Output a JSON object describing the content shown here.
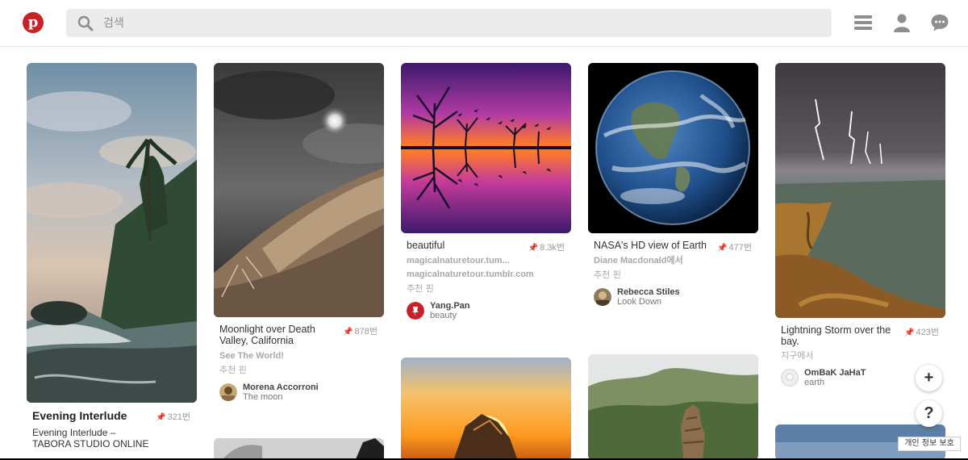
{
  "header": {
    "logo_icon": "pinterest-logo",
    "logo_letter": "p",
    "search_placeholder": "검색",
    "icons": [
      "menu-icon",
      "profile-icon",
      "messages-icon"
    ]
  },
  "pins": [
    {
      "title": "Evening Interlude",
      "count": "321번",
      "description": "Evening Interlude – TABORA STUDIO ONLINE"
    },
    {
      "title": "Moonlight over Death Valley, California",
      "count": "878번",
      "source": "See The World!",
      "recommended": "추천 핀",
      "pinner_name": "Morena Accorroni",
      "pinner_board": "The moon"
    },
    {
      "title": "beautiful",
      "count": "8.3k번",
      "source": "magicalnaturetour.tum...",
      "source2": "magicalnaturetour.tumblr.com",
      "recommended": "추천 핀",
      "pinner_name": "Yang.Pan",
      "pinner_board": "beauty"
    },
    {
      "title": "NASA's HD view of Earth",
      "count": "477번",
      "source": "Diane Macdonald에서",
      "recommended": "추천 핀",
      "pinner_name": "Rebecca Stiles",
      "pinner_board": "Look Down"
    },
    {
      "title": "Lightning Storm over the bay.",
      "count": "423번",
      "recommended": "지구에서",
      "pinner_name": "OmBaK JaHaT",
      "pinner_board": "earth"
    }
  ],
  "floating": {
    "add_label": "+",
    "help_label": "?",
    "privacy_label": "개인 정보 보호"
  },
  "colors": {
    "brand": "#cb2027",
    "search_bg": "#ebebeb"
  }
}
